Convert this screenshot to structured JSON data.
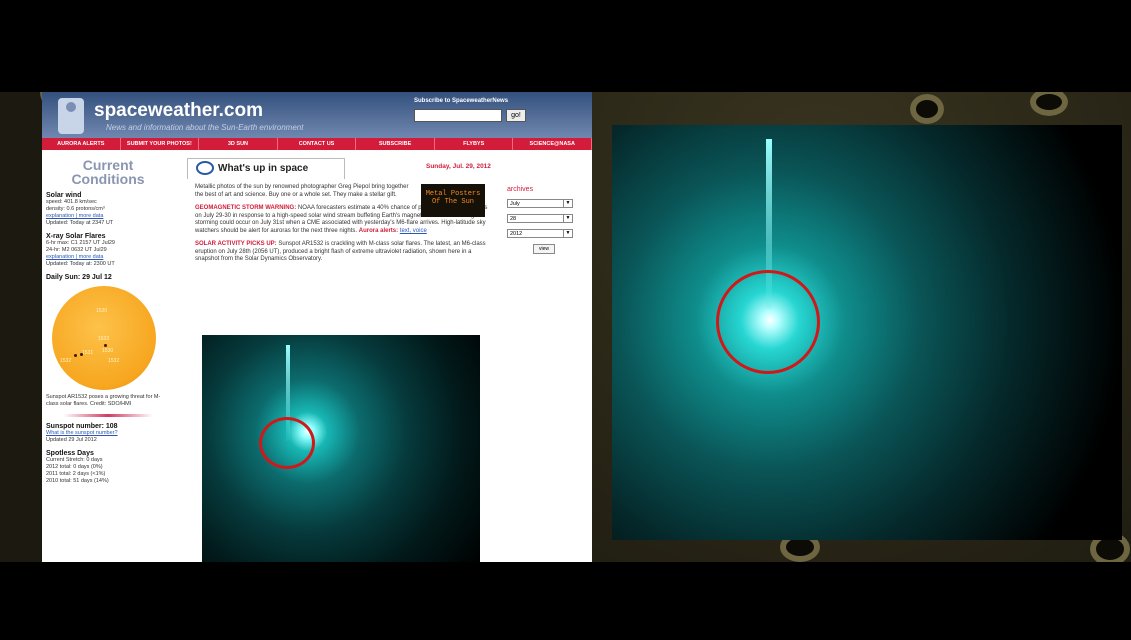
{
  "site": {
    "title": "spaceweather.com",
    "tagline": "News and information about the Sun-Earth environment",
    "subscribe": {
      "label": "Subscribe to SpaceweatherNews",
      "button": "go!"
    }
  },
  "nav": [
    "AURORA ALERTS",
    "SUBMIT YOUR PHOTOS!",
    "3D SUN",
    "CONTACT US",
    "SUBSCRIBE",
    "FLYBYS",
    "SCIENCE@NASA"
  ],
  "sidebar": {
    "heading": "Current Conditions",
    "solar_wind": {
      "title": "Solar wind",
      "speed": "speed: 401.8 km/sec",
      "density": "density: 0.6 protons/cm³",
      "links": "explanation | more data",
      "updated": "Updated: Today at 2347 UT"
    },
    "xray": {
      "title": "X-ray Solar Flares",
      "max6": "6-hr max: C1 2157 UT Jul29",
      "max24": "24-hr: M2 0632 UT Jul29",
      "links": "explanation | more data",
      "updated": "Updated: Today at: 2300 UT"
    },
    "daily_sun": {
      "title": "Daily Sun: 29 Jul 12",
      "labels": [
        "1520",
        "1523",
        "1532",
        "1531",
        "1530",
        "1532"
      ],
      "caption": "Sunspot AR1532 poses a growing threat for M-class solar flares. Credit: SDO/HMI"
    },
    "sunspot": {
      "title": "Sunspot number: 108",
      "link": "What is the sunspot number?",
      "updated": "Updated 29 Jul 2012"
    },
    "spotless": {
      "title": "Spotless Days",
      "lines": [
        "Current Stretch: 0 days",
        "2012 total: 0 days (0%)",
        "2011 total: 2 days (<1%)",
        "2010 total: 51 days (14%)"
      ]
    }
  },
  "main": {
    "tab_title": "What's up in space",
    "date": "Sunday, Jul. 29, 2012",
    "intro": "Metallic photos of the sun by renowned photographer Greg Piepol bring together the best of art and science. Buy one or a whole set. They make a stellar gift.",
    "poster": "Metal Posters Of The Sun",
    "storm_head": "GEOMAGNETIC STORM WARNING:",
    "storm_text": "NOAA forecasters estimate a 40% chance of polar geomagnetic storms on July 29-30 in response to a high-speed solar wind stream buffeting Earth's magnetic field. Even stronger storming could occur on July 31st when a CME associated with yesterday's M6-flare arrives. High-latitude sky watchers should be alert for auroras for the next three nights.",
    "storm_alert": "Aurora alerts:",
    "storm_links": "text, voice",
    "activity_head": "SOLAR ACTIVITY PICKS UP:",
    "activity_text": "Sunspot AR1532 is crackling with M-class solar flares. The latest, an M6-class eruption on July 28th (2056 UT), produced a bright flash of extreme ultraviolet radiation, shown here in a snapshot from the Solar Dynamics Observatory."
  },
  "archives": {
    "label": "archives",
    "month": "July",
    "day": "28",
    "year": "2012",
    "view": "view"
  },
  "colors": {
    "nav_red": "#d21c3a",
    "header_blue": "#33507d",
    "flare_teal": "#17b7b4",
    "circle_red": "#d01818"
  }
}
